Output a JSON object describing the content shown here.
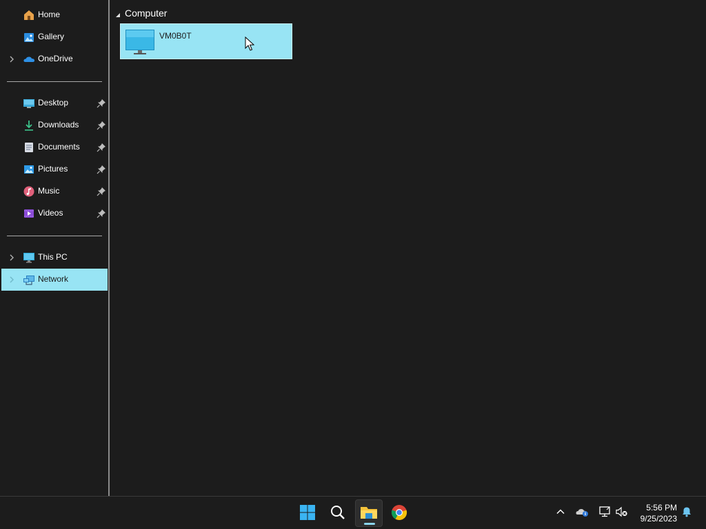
{
  "sidebar": {
    "items": [
      {
        "label": "Home",
        "icon": "home-icon"
      },
      {
        "label": "Gallery",
        "icon": "gallery-icon"
      },
      {
        "label": "OneDrive",
        "icon": "onedrive-cloud-icon"
      },
      {
        "label": "Desktop",
        "icon": "desktop-icon",
        "pinned": true
      },
      {
        "label": "Downloads",
        "icon": "downloads-icon",
        "pinned": true
      },
      {
        "label": "Documents",
        "icon": "documents-icon",
        "pinned": true
      },
      {
        "label": "Pictures",
        "icon": "pictures-icon",
        "pinned": true
      },
      {
        "label": "Music",
        "icon": "music-icon",
        "pinned": true
      },
      {
        "label": "Videos",
        "icon": "videos-icon",
        "pinned": true
      },
      {
        "label": "This PC",
        "icon": "this-pc-icon"
      },
      {
        "label": "Network",
        "icon": "network-icon",
        "selected": true
      }
    ]
  },
  "main": {
    "group_header": "Computer",
    "items": [
      {
        "name": "VM0B0T",
        "icon": "computer-monitor-icon",
        "selected": true
      }
    ]
  },
  "taskbar": {
    "apps": [
      "start-icon",
      "search-icon",
      "file-explorer-icon",
      "chrome-icon"
    ],
    "active_app": "file-explorer-icon",
    "tray_icons": [
      "chevron-up-icon",
      "onedrive-status-icon",
      "network-status-icon",
      "volume-muted-icon",
      "notification-bell-icon"
    ],
    "time": "5:56 PM",
    "date": "9/25/2023"
  },
  "colors": {
    "background": "#1c1c1c",
    "selection": "#98e4f4",
    "accent": "#0078d4"
  }
}
